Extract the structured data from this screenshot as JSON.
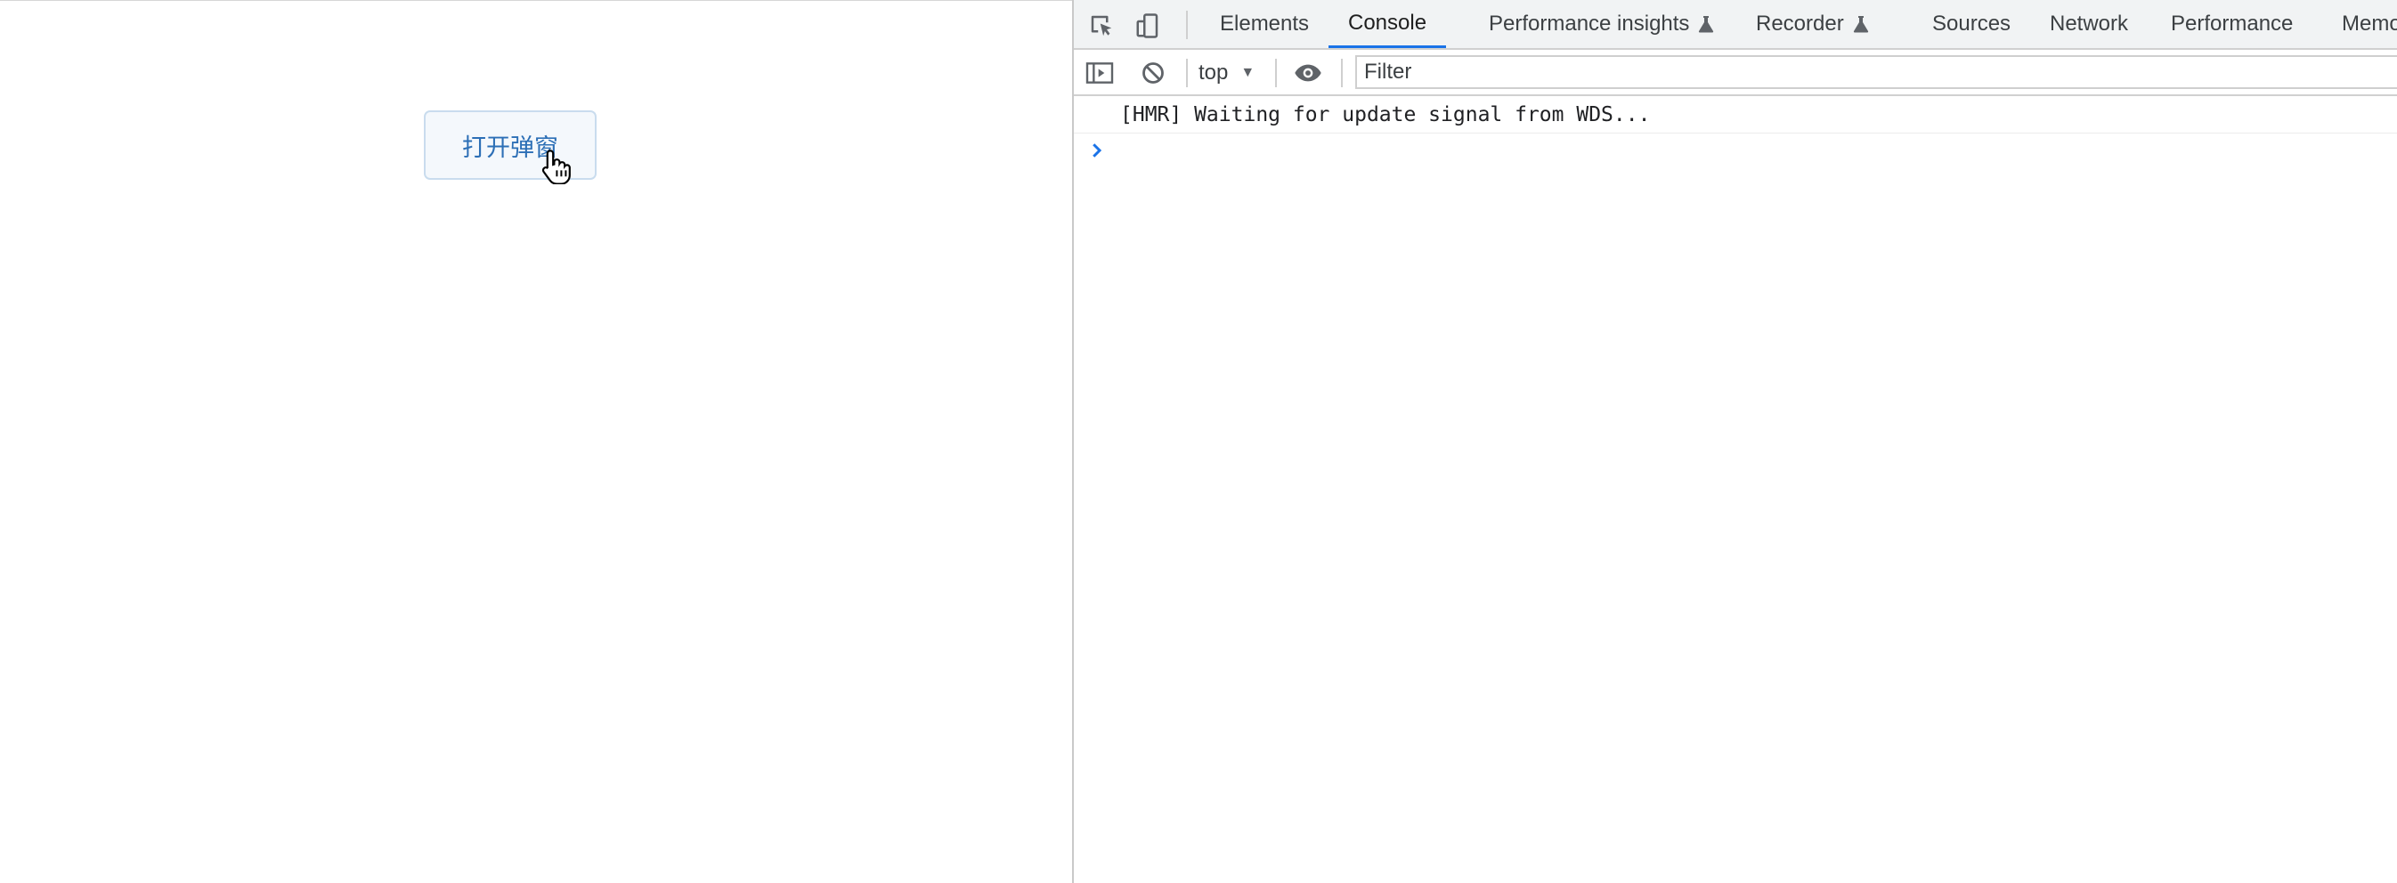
{
  "page": {
    "open_modal_label": "打开弹窗"
  },
  "devtools": {
    "tabs": [
      {
        "label": "Elements",
        "active": false
      },
      {
        "label": "Console",
        "active": true
      },
      {
        "label": "Performance insights",
        "active": false,
        "experimental": true
      },
      {
        "label": "Recorder",
        "active": false,
        "experimental": true
      },
      {
        "label": "Sources",
        "active": false
      },
      {
        "label": "Network",
        "active": false
      },
      {
        "label": "Performance",
        "active": false
      },
      {
        "label": "Memo",
        "active": false
      }
    ],
    "toolbar": {
      "context": "top",
      "filter_placeholder": "Filter"
    },
    "messages": [
      "[HMR] Waiting for update signal from WDS..."
    ],
    "icons": {
      "inspect": "inspect-element-icon",
      "device": "device-toolbar-icon",
      "sidebar": "show-sidebar-icon",
      "clear": "clear-console-icon",
      "eye": "live-expression-icon",
      "prompt": "chevron-right-icon"
    },
    "colors": {
      "accent": "#1a73e8",
      "button_text": "#2c6fb6"
    }
  }
}
